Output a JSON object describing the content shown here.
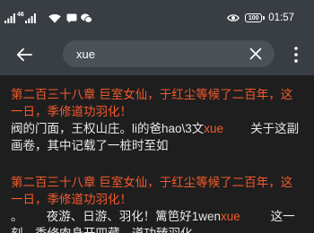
{
  "status_bar": {
    "network_type": "46",
    "battery_level": "100",
    "time": "01:57"
  },
  "status_icons": {
    "left": [
      "signal-icon",
      "signal-icon",
      "wifi-icon",
      "message-icon",
      "chat-app-icon"
    ],
    "right": [
      "eye-icon",
      "battery-icon"
    ]
  },
  "toolbar": {
    "back_icon": "arrow-left-icon",
    "search_query": "xue",
    "clear_icon": "close-icon",
    "menu_icon": "more-vertical-icon"
  },
  "results": [
    {
      "title_lines": [
        "第二百三十八章 巨室女仙，于红尘等候了二百年，这",
        "一日，季修道功羽化！"
      ],
      "excerpt_lines": [
        {
          "before": "阀的门面，王权山庄。li的爸hao\\3文",
          "match": "xue",
          "after": "        关于这副"
        },
        {
          "text": "画卷，其中记载了一桩时至如"
        }
      ]
    },
    {
      "title_lines": [
        "第二百三十八章 巨室女仙，于红尘等候了二百年，这",
        "一日，季修道功羽化！"
      ],
      "excerpt_lines": [
        {
          "before": "。       夜游、日游、羽化！篱笆好1wen",
          "match": "xue",
          "after": "         这一"
        },
        {
          "text": "刻，季修肉身开四藏，道功臻羽化"
        }
      ]
    }
  ],
  "colors": {
    "app_bar": "#383e44",
    "search_box": "#4a5157",
    "content_background": "#1e1e1e",
    "result_title": "#f45a2c",
    "match_highlight": "#f45a2c",
    "excerpt_text": "#e8e8e8",
    "icon": "#ffffff"
  }
}
